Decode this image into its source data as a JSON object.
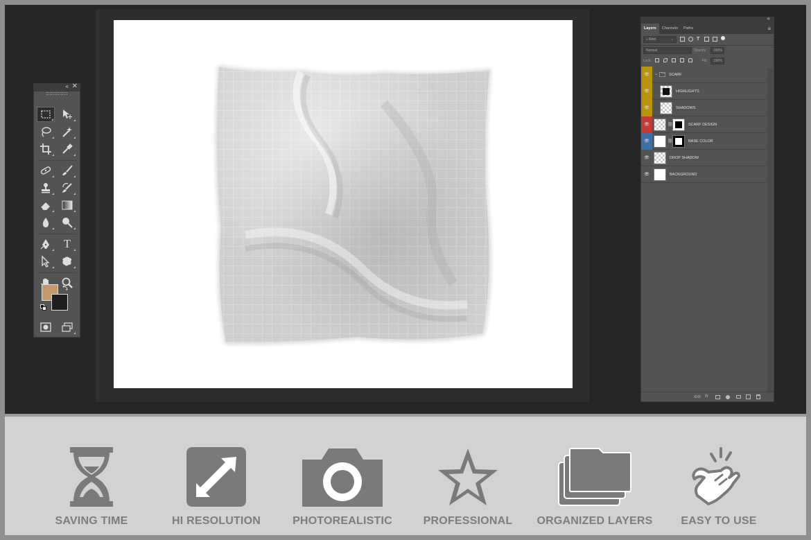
{
  "toolbox": {
    "collapse_glyph": "«",
    "close_glyph": "✕",
    "tools": [
      {
        "name": "rectangular-marquee-tool",
        "icon": "marquee-icon"
      },
      {
        "name": "move-tool",
        "icon": "move-icon"
      },
      {
        "name": "lasso-tool",
        "icon": "lasso-icon"
      },
      {
        "name": "magic-wand-tool",
        "icon": "magic-wand-icon"
      },
      {
        "name": "crop-tool",
        "icon": "crop-icon"
      },
      {
        "name": "eyedropper-tool",
        "icon": "eyedropper-icon"
      },
      {
        "name": "healing-brush-tool",
        "icon": "bandage-icon"
      },
      {
        "name": "brush-tool",
        "icon": "brush-icon"
      },
      {
        "name": "clone-stamp-tool",
        "icon": "stamp-icon"
      },
      {
        "name": "history-brush-tool",
        "icon": "history-brush-icon"
      },
      {
        "name": "eraser-tool",
        "icon": "eraser-icon"
      },
      {
        "name": "gradient-tool",
        "icon": "gradient-icon"
      },
      {
        "name": "blur-tool",
        "icon": "droplet-icon"
      },
      {
        "name": "dodge-tool",
        "icon": "dodge-icon"
      },
      {
        "name": "pen-tool",
        "icon": "pen-icon"
      },
      {
        "name": "type-tool",
        "icon": "type-icon"
      },
      {
        "name": "path-selection-tool",
        "icon": "arrow-icon"
      },
      {
        "name": "custom-shape-tool",
        "icon": "shape-icon"
      },
      {
        "name": "hand-tool",
        "icon": "hand-icon"
      },
      {
        "name": "zoom-tool",
        "icon": "zoom-icon"
      }
    ],
    "type_glyph": "T",
    "foreground_color": "#c49a6c",
    "background_color": "#1f1f1f"
  },
  "layers_panel": {
    "collapse_glyph": "«",
    "tabs": [
      "Layers",
      "Channels",
      "Paths"
    ],
    "menu_glyph": "≡",
    "filter_kind": "Kind",
    "blend_mode": "Normal",
    "opacity_label": "Opacity:",
    "opacity_value": "100%",
    "lock_label": "Lock:",
    "fill_label": "Fill:",
    "fill_value": "100%",
    "eye_glyph": "👁",
    "layers": [
      {
        "name": "SCARF",
        "type": "group",
        "tag_color": "#b8940c"
      },
      {
        "name": "HIGHLIGHTS",
        "type": "layer",
        "tag_color": "#b8940c"
      },
      {
        "name": "SHADOWS",
        "type": "layer",
        "tag_color": "#b8940c"
      },
      {
        "name": "SCARF DESIGN",
        "type": "smart-masked",
        "tag_color": "#c23b3b"
      },
      {
        "name": "BASE COLOR",
        "type": "masked",
        "tag_color": "#3f6fa8"
      },
      {
        "name": "DROP SHADOW",
        "type": "layer",
        "tag_color": ""
      },
      {
        "name": "BACKGROUND",
        "type": "layer",
        "tag_color": ""
      }
    ],
    "footer_glyphs": [
      "⊖⊖",
      "fx"
    ]
  },
  "features": [
    {
      "label": "SAVING TIME",
      "icon": "hourglass-icon"
    },
    {
      "label": "HI RESOLUTION",
      "icon": "expand-arrows-icon"
    },
    {
      "label": "PHOTOREALISTIC",
      "icon": "camera-icon"
    },
    {
      "label": "PROFESSIONAL",
      "icon": "star-icon"
    },
    {
      "label": "ORGANIZED LAYERS",
      "icon": "folders-icon"
    },
    {
      "label": "EASY TO USE",
      "icon": "tap-hand-icon"
    }
  ]
}
